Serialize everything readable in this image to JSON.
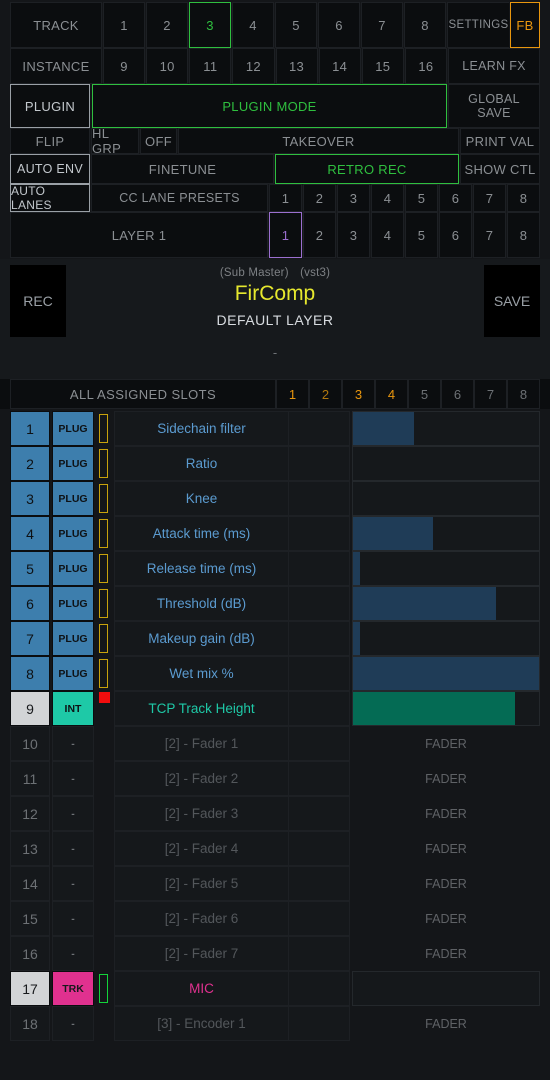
{
  "header": {
    "track_label": "TRACK",
    "track_numbers": [
      "1",
      "2",
      "3",
      "4",
      "5",
      "6",
      "7",
      "8"
    ],
    "track_selected": "3",
    "settings_label": "SETTINGS",
    "fb_label": "FB",
    "instance_label": "INSTANCE",
    "instance_numbers": [
      "9",
      "10",
      "11",
      "12",
      "13",
      "14",
      "15",
      "16"
    ],
    "learn_fx_label": "LEARN FX",
    "plugin_label": "PLUGIN",
    "plugin_mode_label": "PLUGIN MODE",
    "global_save_line1": "GLOBAL",
    "global_save_line2": "SAVE",
    "flip_label": "FLIP",
    "hl_grp_label": "HL GRP",
    "off_label": "OFF",
    "takeover_label": "TAKEOVER",
    "print_val_label": "PRINT VAL",
    "auto_env_label": "AUTO ENV",
    "finetune_label": "FINETUNE",
    "retro_rec_label": "RETRO REC",
    "show_ctl_label": "SHOW CTL",
    "auto_lanes_label": "AUTO LANES",
    "cc_lane_presets_label": "CC LANE PRESETS",
    "cc_lane_numbers": [
      "1",
      "2",
      "3",
      "4",
      "5",
      "6",
      "7",
      "8"
    ],
    "layer_label": "LAYER 1",
    "layer_numbers": [
      "1",
      "2",
      "3",
      "4",
      "5",
      "6",
      "7",
      "8"
    ],
    "layer_selected": "1"
  },
  "title": {
    "rec_label": "REC",
    "save_label": "SAVE",
    "sub_master": "(Sub Master)",
    "format": "(vst3)",
    "plugin_name": "FirComp",
    "layer_name": "DEFAULT LAYER",
    "dash": "-"
  },
  "slots": {
    "label": "ALL ASSIGNED SLOTS",
    "numbers": [
      {
        "n": "1",
        "state": "on"
      },
      {
        "n": "2",
        "state": "current"
      },
      {
        "n": "3",
        "state": "on"
      },
      {
        "n": "4",
        "state": "on"
      },
      {
        "n": "5",
        "state": "off"
      },
      {
        "n": "6",
        "state": "off"
      },
      {
        "n": "7",
        "state": "off"
      },
      {
        "n": "8",
        "state": "off"
      }
    ]
  },
  "colors": {
    "accent_green": "#2fbf3f",
    "accent_orange": "#e8960e",
    "accent_purple": "#9b6fcf",
    "accent_yellow": "#e6e82e",
    "blue": "#3d7ead",
    "teal": "#1ec9a7",
    "pink": "#e0318f",
    "red": "#f20d0d",
    "gold": "#c8a20c",
    "fill_blue": "#1f3c57",
    "fill_teal": "#046b54"
  },
  "params": [
    {
      "num": "1",
      "type": "PLUG",
      "label": "Sidechain filter",
      "value": "",
      "bar": 33,
      "fill": "blue",
      "skin": "blue",
      "marker": "gold",
      "fader": false
    },
    {
      "num": "2",
      "type": "PLUG",
      "label": "Ratio",
      "value": "",
      "bar": 0,
      "fill": "blue",
      "skin": "blue",
      "marker": "gold",
      "fader": false
    },
    {
      "num": "3",
      "type": "PLUG",
      "label": "Knee",
      "value": "",
      "bar": 0,
      "fill": "blue",
      "skin": "blue",
      "marker": "gold",
      "fader": false
    },
    {
      "num": "4",
      "type": "PLUG",
      "label": "Attack time (ms)",
      "value": "",
      "bar": 43,
      "fill": "blue",
      "skin": "blue",
      "marker": "gold",
      "fader": false
    },
    {
      "num": "5",
      "type": "PLUG",
      "label": "Release time (ms)",
      "value": "",
      "bar": 4,
      "fill": "blue",
      "skin": "blue",
      "marker": "gold",
      "fader": false
    },
    {
      "num": "6",
      "type": "PLUG",
      "label": "Threshold (dB)",
      "value": "",
      "bar": 77,
      "fill": "blue",
      "skin": "blue",
      "marker": "gold",
      "fader": false
    },
    {
      "num": "7",
      "type": "PLUG",
      "label": "Makeup gain (dB)",
      "value": "",
      "bar": 4,
      "fill": "blue",
      "skin": "blue",
      "marker": "gold",
      "fader": false
    },
    {
      "num": "8",
      "type": "PLUG",
      "label": "Wet mix %",
      "value": "",
      "bar": 100,
      "fill": "blue",
      "skin": "blue",
      "marker": "gold",
      "fader": false
    },
    {
      "num": "9",
      "type": "INT",
      "label": "TCP Track Height",
      "value": "",
      "bar": 87,
      "fill": "teal",
      "skin": "int",
      "marker": "red",
      "fader": false
    },
    {
      "num": "10",
      "type": "-",
      "label": "[2] - Fader 1",
      "value": "",
      "bar": 0,
      "fill": "none",
      "skin": "dim",
      "marker": "none",
      "fader": true,
      "fader_label": "FADER"
    },
    {
      "num": "11",
      "type": "-",
      "label": "[2] - Fader 2",
      "value": "",
      "bar": 0,
      "fill": "none",
      "skin": "dim",
      "marker": "none",
      "fader": true,
      "fader_label": "FADER"
    },
    {
      "num": "12",
      "type": "-",
      "label": "[2] - Fader 3",
      "value": "",
      "bar": 0,
      "fill": "none",
      "skin": "dim",
      "marker": "none",
      "fader": true,
      "fader_label": "FADER"
    },
    {
      "num": "13",
      "type": "-",
      "label": "[2] - Fader 4",
      "value": "",
      "bar": 0,
      "fill": "none",
      "skin": "dim",
      "marker": "none",
      "fader": true,
      "fader_label": "FADER"
    },
    {
      "num": "14",
      "type": "-",
      "label": "[2] - Fader 5",
      "value": "",
      "bar": 0,
      "fill": "none",
      "skin": "dim",
      "marker": "none",
      "fader": true,
      "fader_label": "FADER"
    },
    {
      "num": "15",
      "type": "-",
      "label": "[2] - Fader 6",
      "value": "",
      "bar": 0,
      "fill": "none",
      "skin": "dim",
      "marker": "none",
      "fader": true,
      "fader_label": "FADER"
    },
    {
      "num": "16",
      "type": "-",
      "label": "[2] - Fader 7",
      "value": "",
      "bar": 0,
      "fill": "none",
      "skin": "dim",
      "marker": "none",
      "fader": true,
      "fader_label": "FADER"
    },
    {
      "num": "17",
      "type": "TRK",
      "label": "MIC",
      "value": "",
      "bar": 0,
      "fill": "none",
      "skin": "trk",
      "marker": "green",
      "fader": false
    },
    {
      "num": "18",
      "type": "-",
      "label": "[3] - Encoder 1",
      "value": "",
      "bar": 0,
      "fill": "none",
      "skin": "dim",
      "marker": "none",
      "fader": true,
      "fader_label": "FADER"
    }
  ]
}
